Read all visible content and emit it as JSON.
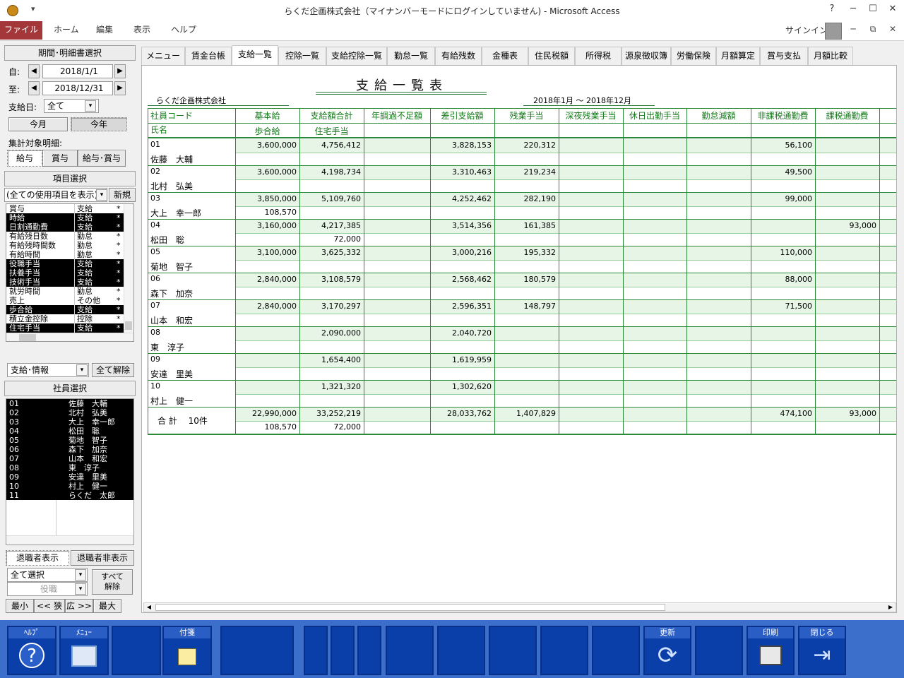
{
  "window": {
    "title": "らくだ企画株式会社（マイナンバーモードにログインしていません) - Microsoft Access",
    "signin": "サインイン"
  },
  "ribbon": {
    "tabs": [
      "ファイル",
      "ホーム",
      "編集",
      "表示",
      "ヘルプ"
    ]
  },
  "left": {
    "period_header": "期間･明細書選択",
    "from_label": "自:",
    "from_value": "2018/1/1",
    "to_label": "至:",
    "to_value": "2018/12/31",
    "payday_label": "支給日:",
    "payday_value": "全て",
    "this_month": "今月",
    "this_year": "今年",
    "target_label": "集計対象明細:",
    "target_opts": [
      "給与",
      "賞与",
      "給与･賞与"
    ],
    "item_header": "項目選択",
    "item_filter": "(全ての使用項目を表示)",
    "new_btn": "新規",
    "items": [
      {
        "name": "賞与",
        "kind": "支給",
        "mark": "*",
        "sel": false
      },
      {
        "name": "時給",
        "kind": "支給",
        "mark": "*",
        "sel": true
      },
      {
        "name": "日割通勤費",
        "kind": "支給",
        "mark": "*",
        "sel": true
      },
      {
        "name": "有給残日数",
        "kind": "勤怠",
        "mark": "*",
        "sel": false
      },
      {
        "name": "有給残時間数",
        "kind": "勤怠",
        "mark": "*",
        "sel": false
      },
      {
        "name": "有給時間",
        "kind": "勤怠",
        "mark": "*",
        "sel": false
      },
      {
        "name": "役職手当",
        "kind": "支給",
        "mark": "*",
        "sel": true
      },
      {
        "name": "扶養手当",
        "kind": "支給",
        "mark": "*",
        "sel": true
      },
      {
        "name": "技術手当",
        "kind": "支給",
        "mark": "*",
        "sel": true
      },
      {
        "name": "就労時間",
        "kind": "勤怠",
        "mark": "*",
        "sel": false
      },
      {
        "name": "売上",
        "kind": "その他",
        "mark": "*",
        "sel": false
      },
      {
        "name": "歩合給",
        "kind": "支給",
        "mark": "*",
        "sel": true
      },
      {
        "name": "積立金控除",
        "kind": "控除",
        "mark": "*",
        "sel": false
      },
      {
        "name": "住宅手当",
        "kind": "支給",
        "mark": "*",
        "sel": true
      },
      {
        "name": "所定時間",
        "kind": "勤怠",
        "mark": "*",
        "sel": false
      }
    ],
    "item_kind_value": "支給･情報",
    "clear_all": "全て解除",
    "emp_header": "社員選択",
    "employees": [
      {
        "code": "01",
        "name": "佐藤　大輔"
      },
      {
        "code": "02",
        "name": "北村　弘美"
      },
      {
        "code": "03",
        "name": "大上　幸一郎"
      },
      {
        "code": "04",
        "name": "松田　聡"
      },
      {
        "code": "05",
        "name": "菊地　智子"
      },
      {
        "code": "06",
        "name": "森下　加奈"
      },
      {
        "code": "07",
        "name": "山本　和宏"
      },
      {
        "code": "08",
        "name": "東　淳子"
      },
      {
        "code": "09",
        "name": "安達　里美"
      },
      {
        "code": "10",
        "name": "村上　健一"
      },
      {
        "code": "11",
        "name": "らくだ　太郎"
      }
    ],
    "retired_show": "退職者表示",
    "retired_hide": "退職者非表示",
    "select_all": "全て選択",
    "position": "役職",
    "deselect_all": "すべて\n解除",
    "zoom": [
      "最小",
      "<< 狭",
      "広 >>",
      "最大"
    ]
  },
  "doc_tabs": [
    "メニュー",
    "賃金台帳",
    "支給一覧",
    "控除一覧",
    "支給控除一覧",
    "勤怠一覧",
    "有給残数",
    "金種表",
    "住民税額",
    "所得税",
    "源泉徴収簿",
    "労働保険",
    "月額算定",
    "賞与支払",
    "月額比較"
  ],
  "active_tab": 2,
  "report": {
    "title": "支給一覧表",
    "company": "らくだ企画株式会社",
    "period": "2018年1月 ～ 2018年12月",
    "col_code": "社員コード",
    "col_name": "氏名",
    "cols_top": [
      "基本給",
      "支給額合計",
      "年調過不足額",
      "差引支給額",
      "残業手当",
      "深夜残業手当",
      "休日出勤手当",
      "勤怠減額",
      "非課税通勤費",
      "課税通勤費"
    ],
    "cols_bottom": [
      "歩合給",
      "住宅手当",
      "",
      "",
      "",
      "",
      "",
      "",
      "",
      ""
    ],
    "rows": [
      {
        "code": "01",
        "name": "佐藤　大輔",
        "top": [
          "3,600,000",
          "4,756,412",
          "",
          "3,828,153",
          "220,312",
          "",
          "",
          "",
          "56,100",
          ""
        ],
        "bottom": [
          "",
          "",
          "",
          "",
          "",
          "",
          "",
          "",
          "",
          ""
        ]
      },
      {
        "code": "02",
        "name": "北村　弘美",
        "top": [
          "3,600,000",
          "4,198,734",
          "",
          "3,310,463",
          "219,234",
          "",
          "",
          "",
          "49,500",
          ""
        ],
        "bottom": [
          "",
          "",
          "",
          "",
          "",
          "",
          "",
          "",
          "",
          ""
        ]
      },
      {
        "code": "03",
        "name": "大上　幸一郎",
        "top": [
          "3,850,000",
          "5,109,760",
          "",
          "4,252,462",
          "282,190",
          "",
          "",
          "",
          "99,000",
          ""
        ],
        "bottom": [
          "108,570",
          "",
          "",
          "",
          "",
          "",
          "",
          "",
          "",
          ""
        ]
      },
      {
        "code": "04",
        "name": "松田　聡",
        "top": [
          "3,160,000",
          "4,217,385",
          "",
          "3,514,356",
          "161,385",
          "",
          "",
          "",
          "",
          "93,000"
        ],
        "bottom": [
          "",
          "72,000",
          "",
          "",
          "",
          "",
          "",
          "",
          "",
          ""
        ]
      },
      {
        "code": "05",
        "name": "菊地　智子",
        "top": [
          "3,100,000",
          "3,625,332",
          "",
          "3,000,216",
          "195,332",
          "",
          "",
          "",
          "110,000",
          ""
        ],
        "bottom": [
          "",
          "",
          "",
          "",
          "",
          "",
          "",
          "",
          "",
          ""
        ]
      },
      {
        "code": "06",
        "name": "森下　加奈",
        "top": [
          "2,840,000",
          "3,108,579",
          "",
          "2,568,462",
          "180,579",
          "",
          "",
          "",
          "88,000",
          ""
        ],
        "bottom": [
          "",
          "",
          "",
          "",
          "",
          "",
          "",
          "",
          "",
          ""
        ]
      },
      {
        "code": "07",
        "name": "山本　和宏",
        "top": [
          "2,840,000",
          "3,170,297",
          "",
          "2,596,351",
          "148,797",
          "",
          "",
          "",
          "71,500",
          ""
        ],
        "bottom": [
          "",
          "",
          "",
          "",
          "",
          "",
          "",
          "",
          "",
          ""
        ]
      },
      {
        "code": "08",
        "name": "東　淳子",
        "top": [
          "",
          "2,090,000",
          "",
          "2,040,720",
          "",
          "",
          "",
          "",
          "",
          ""
        ],
        "bottom": [
          "",
          "",
          "",
          "",
          "",
          "",
          "",
          "",
          "",
          ""
        ]
      },
      {
        "code": "09",
        "name": "安達　里美",
        "top": [
          "",
          "1,654,400",
          "",
          "1,619,959",
          "",
          "",
          "",
          "",
          "",
          ""
        ],
        "bottom": [
          "",
          "",
          "",
          "",
          "",
          "",
          "",
          "",
          "",
          ""
        ]
      },
      {
        "code": "10",
        "name": "村上　健一",
        "top": [
          "",
          "1,321,320",
          "",
          "1,302,620",
          "",
          "",
          "",
          "",
          "",
          ""
        ],
        "bottom": [
          "",
          "",
          "",
          "",
          "",
          "",
          "",
          "",
          "",
          ""
        ]
      }
    ],
    "total_label": "合 計　 10件",
    "total_top": [
      "22,990,000",
      "33,252,219",
      "",
      "28,033,762",
      "1,407,829",
      "",
      "",
      "",
      "474,100",
      "93,000"
    ],
    "total_bottom": [
      "108,570",
      "72,000",
      "",
      "",
      "",
      "",
      "",
      "",
      "",
      ""
    ]
  },
  "footer": {
    "keys": [
      {
        "label": "ﾍﾙﾌﾟ",
        "icon": "help-icon"
      },
      {
        "label": "ﾒﾆｭｰ",
        "icon": "menu-icon"
      },
      {
        "label": "",
        "icon": ""
      },
      {
        "label": "付箋",
        "icon": "sticky-note-icon"
      },
      {
        "label": "",
        "icon": ""
      },
      {
        "label": "",
        "icon": ""
      },
      {
        "label": "",
        "icon": ""
      },
      {
        "label": "",
        "icon": ""
      },
      {
        "label": "",
        "icon": ""
      },
      {
        "label": "",
        "icon": ""
      },
      {
        "label": "",
        "icon": ""
      },
      {
        "label": "",
        "icon": ""
      },
      {
        "label": "",
        "icon": ""
      },
      {
        "label": "更新",
        "icon": "refresh-icon"
      },
      {
        "label": "",
        "icon": ""
      },
      {
        "label": "印刷",
        "icon": "printer-icon"
      },
      {
        "label": "閉じる",
        "icon": "exit-icon"
      }
    ]
  }
}
